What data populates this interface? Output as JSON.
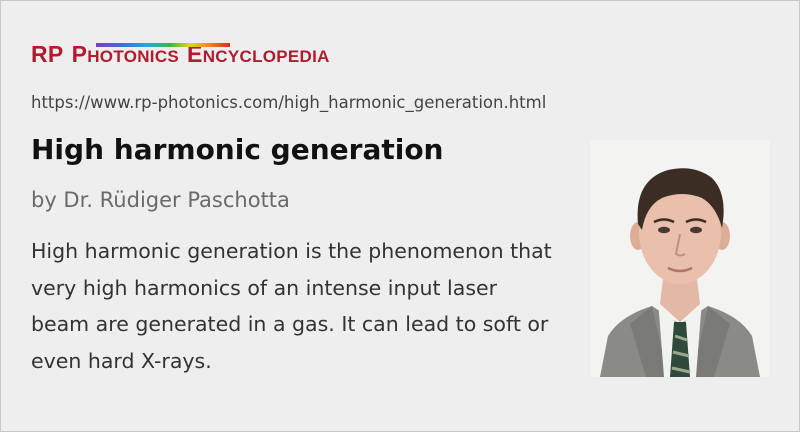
{
  "logo": {
    "prefix": "RP",
    "word1_initial": "P",
    "word1_rest": "HOTONICS",
    "word2_initial": "E",
    "word2_rest": "NCYCLOPEDIA"
  },
  "url": "https://www.rp-photonics.com/high_harmonic_generation.html",
  "title": "High harmonic generation",
  "author": "by Dr. Rüdiger Paschotta",
  "description": "High harmonic generation is the phenomenon that very high harmonics of an intense input laser beam are generated in a gas. It can lead to soft or even hard X-rays.",
  "colors": {
    "brand": "#b01c2e",
    "background": "#eeeeee",
    "title": "#111111",
    "author": "#6a6a6a"
  }
}
